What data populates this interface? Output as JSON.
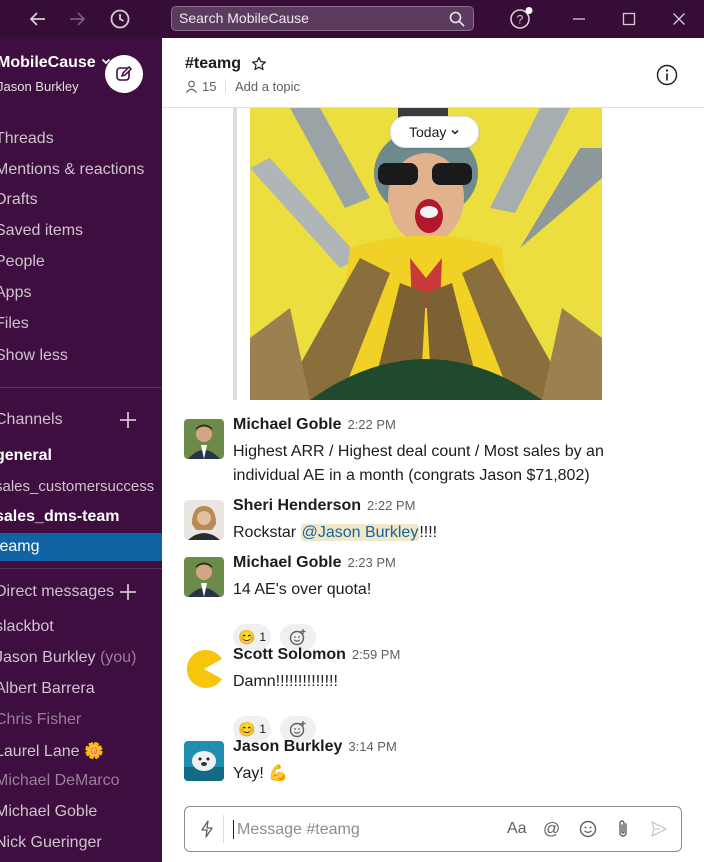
{
  "search": {
    "placeholder": "Search MobileCause"
  },
  "sidebar": {
    "workspace": "MobileCause",
    "user": "Jason Burkley",
    "nav": [
      "Threads",
      "Mentions & reactions",
      "Drafts",
      "Saved items",
      "People",
      "Apps",
      "Files",
      "Show less"
    ],
    "channels_header": "Channels",
    "channels": [
      {
        "label": "general",
        "state": "bold"
      },
      {
        "label": "sales_customersuccess",
        "state": "normal"
      },
      {
        "label": "sales_dms-team",
        "state": "bold"
      },
      {
        "label": "teamg",
        "state": "active"
      }
    ],
    "dm_header": "Direct messages",
    "dms": [
      {
        "label": "slackbot",
        "state": "normal"
      },
      {
        "label": "Jason Burkley",
        "suffix": "(you)",
        "state": "normal"
      },
      {
        "label": "Albert Barrera",
        "state": "normal"
      },
      {
        "label": "Chris Fisher",
        "state": "muted"
      },
      {
        "label": "Laurel Lane",
        "status_emoji": "🌼",
        "state": "normal"
      },
      {
        "label": "Michael DeMarco",
        "state": "muted"
      },
      {
        "label": "Michael Goble",
        "state": "normal"
      },
      {
        "label": "Nick Gueringer",
        "state": "normal"
      }
    ]
  },
  "channel": {
    "name": "#teamg",
    "member_count": "15",
    "topic_placeholder": "Add a topic",
    "date_divider": "Today"
  },
  "messages": [
    {
      "author": "Michael Goble",
      "time": "2:22 PM",
      "text": "Highest ARR / Highest deal count / Most sales by an individual AE in a month (congrats Jason $71,802)"
    },
    {
      "author": "Sheri Henderson",
      "time": "2:22 PM",
      "text_before": "Rockstar ",
      "mention": "@Jason Burkley",
      "text_after": "!!!!"
    },
    {
      "author": "Michael Goble",
      "time": "2:23 PM",
      "text": "14 AE's over quota!",
      "reaction": {
        "emoji": "😊",
        "count": "1"
      }
    },
    {
      "author": "Scott Solomon",
      "time": "2:59 PM",
      "text": "Damn!!!!!!!!!!!!!!",
      "reaction": {
        "emoji": "😊",
        "count": "1"
      }
    },
    {
      "author": "Jason Burkley",
      "time": "3:14 PM",
      "text": "Yay! 💪"
    }
  ],
  "composer": {
    "placeholder": "Message #teamg",
    "format_label": "Aa",
    "mention_label": "@"
  },
  "colors": {
    "sidebar": "#3f0e40",
    "titlebar": "#350d36",
    "active": "#1164a3"
  },
  "icons": [
    "back-arrow-icon",
    "forward-arrow-icon",
    "history-icon",
    "search-icon",
    "help-icon",
    "minimize-icon",
    "maximize-icon",
    "close-icon",
    "compose-icon",
    "plus-icon",
    "star-icon",
    "member-icon",
    "info-icon",
    "chevron-down-icon",
    "add-reaction-icon",
    "lightning-icon",
    "emoji-icon",
    "attachment-icon",
    "send-icon"
  ]
}
